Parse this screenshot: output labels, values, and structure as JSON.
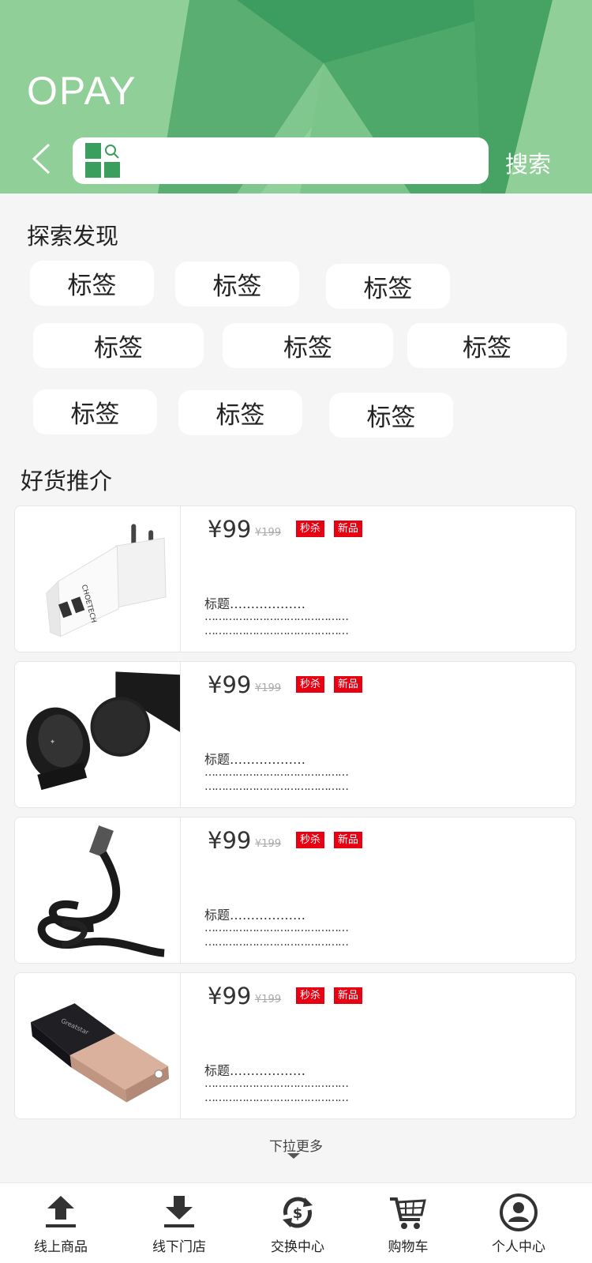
{
  "header": {
    "brand": "OPAY",
    "search_button": "搜索",
    "search_placeholder": ""
  },
  "explore": {
    "title": "探索发现",
    "tags": [
      "标签",
      "标签",
      "标签",
      "标签",
      "标签",
      "标签",
      "标签",
      "标签",
      "标签"
    ]
  },
  "recommend": {
    "title": "好货推介",
    "products": [
      {
        "price": "¥99",
        "old_price": "¥199",
        "badge1": "秒杀",
        "badge2": "新品",
        "title": "标题………………",
        "line1": "……………………………………",
        "line2": "……………………………………",
        "image": "usb-charger"
      },
      {
        "price": "¥99",
        "old_price": "¥199",
        "badge1": "秒杀",
        "badge2": "新品",
        "title": "标题………………",
        "line1": "……………………………………",
        "line2": "……………………………………",
        "image": "magnetic-car-mount"
      },
      {
        "price": "¥99",
        "old_price": "¥199",
        "badge1": "秒杀",
        "badge2": "新品",
        "title": "标题………………",
        "line1": "……………………………………",
        "line2": "……………………………………",
        "image": "flat-cable"
      },
      {
        "price": "¥99",
        "old_price": "¥199",
        "badge1": "秒杀",
        "badge2": "新品",
        "title": "标题………………",
        "line1": "……………………………………",
        "line2": "……………………………………",
        "image": "power-bank"
      }
    ]
  },
  "more_text": "下拉更多",
  "tabbar": {
    "items": [
      {
        "label": "线上商品",
        "icon": "upload-icon"
      },
      {
        "label": "线下门店",
        "icon": "download-icon"
      },
      {
        "label": "交换中心",
        "icon": "exchange-icon"
      },
      {
        "label": "购物车",
        "icon": "cart-icon"
      },
      {
        "label": "个人中心",
        "icon": "user-icon"
      }
    ]
  },
  "colors": {
    "brand_green": "#3a9e5f",
    "badge_red": "#e60012",
    "header_light": "#90cf98"
  }
}
